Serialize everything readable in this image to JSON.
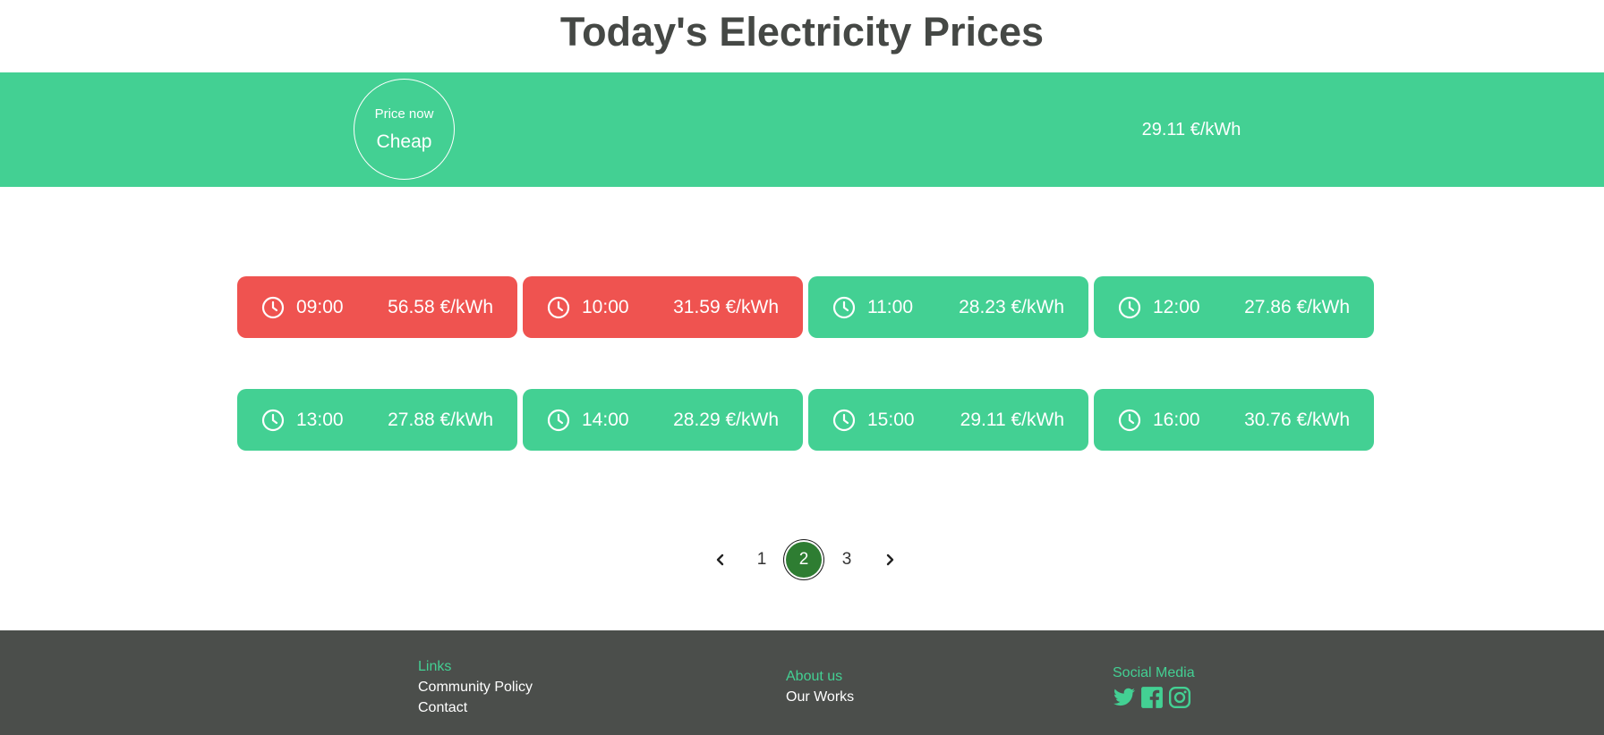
{
  "title": "Today's Electricity Prices",
  "banner": {
    "price_now_label": "Price now",
    "status": "Cheap",
    "current_price": "29.11 €/kWh"
  },
  "hours": [
    {
      "time": "09:00",
      "price": "56.58 €/kWh",
      "level": "expensive"
    },
    {
      "time": "10:00",
      "price": "31.59 €/kWh",
      "level": "expensive"
    },
    {
      "time": "11:00",
      "price": "28.23 €/kWh",
      "level": "cheap"
    },
    {
      "time": "12:00",
      "price": "27.86 €/kWh",
      "level": "cheap"
    },
    {
      "time": "13:00",
      "price": "27.88 €/kWh",
      "level": "cheap"
    },
    {
      "time": "14:00",
      "price": "28.29 €/kWh",
      "level": "cheap"
    },
    {
      "time": "15:00",
      "price": "29.11 €/kWh",
      "level": "cheap"
    },
    {
      "time": "16:00",
      "price": "30.76 €/kWh",
      "level": "cheap"
    }
  ],
  "pagination": {
    "pages": [
      "1",
      "2",
      "3"
    ],
    "current": "2"
  },
  "footer": {
    "links": {
      "heading": "Links",
      "items": [
        "Community Policy",
        "Contact"
      ]
    },
    "about": {
      "heading": "About us",
      "items": [
        "Our Works"
      ]
    },
    "social": {
      "heading": "Social Media",
      "icons": [
        "twitter-icon",
        "facebook-icon",
        "instagram-icon"
      ]
    }
  },
  "colors": {
    "cheap": "#43d093",
    "expensive": "#ef5350",
    "active_page": "#2e7d32",
    "footer_bg": "#4b4e4b"
  }
}
